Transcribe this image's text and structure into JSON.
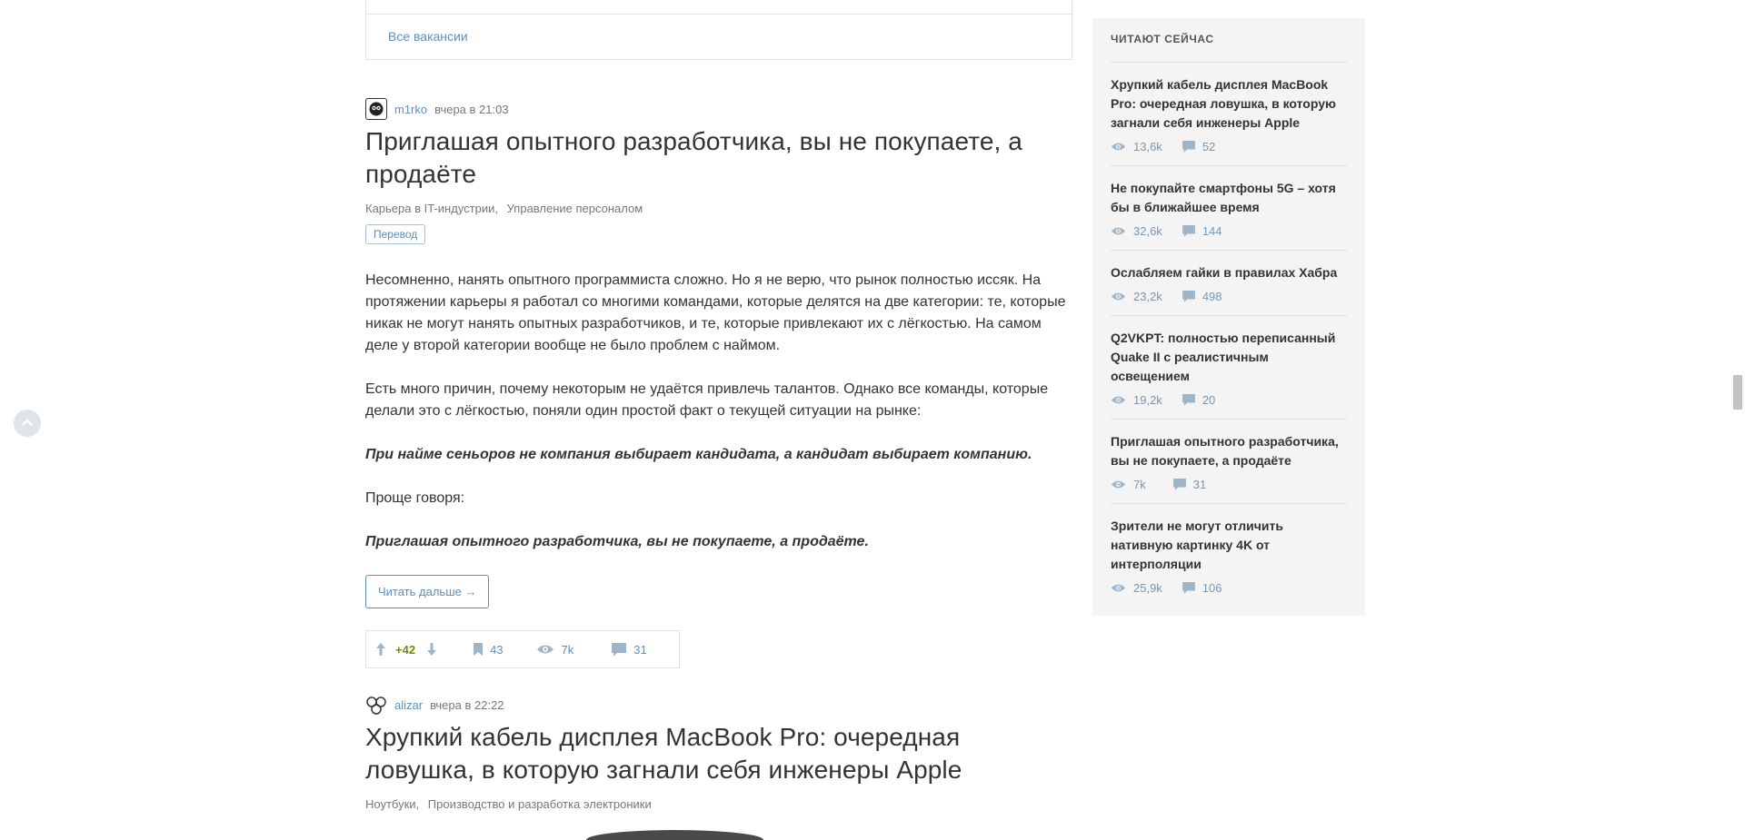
{
  "vacancies": {
    "all_link": "Все вакансии"
  },
  "posts": [
    {
      "author": "m1rko",
      "time": "вчера в 21:03",
      "title": "Приглашая опытного разработчика, вы не покупаете, а продаёте",
      "hubs": [
        "Карьера в IT-индустрии,",
        "Управление персоналом"
      ],
      "badge": "Перевод",
      "paragraphs": [
        "Несомненно, нанять опытного программиста сложно. Но я не верю, что рынок полностью иссяк. На протяжении карьеры я работал со многими командами, которые делятся на две категории: те, которые никак не могут нанять опытных разработчиков, и те, которые привлекают их с лёгкостью. На самом деле у второй категории вообще не было проблем с наймом.",
        "Есть много причин, почему некоторым не удаётся привлечь талантов. Однако все команды, которые делали это с лёгкостью, поняли один простой факт о текущей ситуации на рынке:",
        "При найме сеньоров не компания выбирает кандидата, а кандидат выбирает компанию.",
        "Проще говоря:",
        "Приглашая опытного разработчика, вы не покупаете, а продаёте."
      ],
      "read_more": "Читать дальше →",
      "stats": {
        "votes": "+42",
        "bookmarks": "43",
        "views": "7k",
        "comments": "31"
      }
    },
    {
      "author": "alizar",
      "time": "вчера в 22:22",
      "title": "Хрупкий кабель дисплея MacBook Pro: очередная ловушка, в которую загнали себя инженеры Apple",
      "hubs": [
        "Ноутбуки,",
        "Производство и разработка электроники"
      ]
    }
  ],
  "sidebar": {
    "heading": "ЧИТАЮТ СЕЙЧАС",
    "items": [
      {
        "title": "Хрупкий кабель дисплея MacBook Pro: очередная ловушка, в которую загнали себя инженеры Apple",
        "views": "13,6k",
        "comments": "52"
      },
      {
        "title": "Не покупайте смартфоны 5G – хотя бы в ближайшее время",
        "views": "32,6k",
        "comments": "144"
      },
      {
        "title": "Ослабляем гайки в правилах Хабра",
        "views": "23,2k",
        "comments": "498"
      },
      {
        "title": "Q2VKPT: полностью переписанный Quake II с реалистичным освещением",
        "views": "19,2k",
        "comments": "20"
      },
      {
        "title": "Приглашая опытного разработчика, вы не покупаете, а продаёте",
        "views": "7k",
        "comments": "31"
      },
      {
        "title": "Зрители не могут отличить нативную картинку 4K от интерполяции",
        "views": "25,9k",
        "comments": "106"
      }
    ]
  },
  "colors": {
    "link": "#5e8fb7",
    "positive_votes": "#6c9007",
    "sidebar_bg": "#f4f4f4"
  },
  "icons": [
    "chevron-up-icon",
    "arrow-up-icon",
    "arrow-down-icon",
    "bookmark-icon",
    "eye-icon",
    "comment-icon"
  ]
}
